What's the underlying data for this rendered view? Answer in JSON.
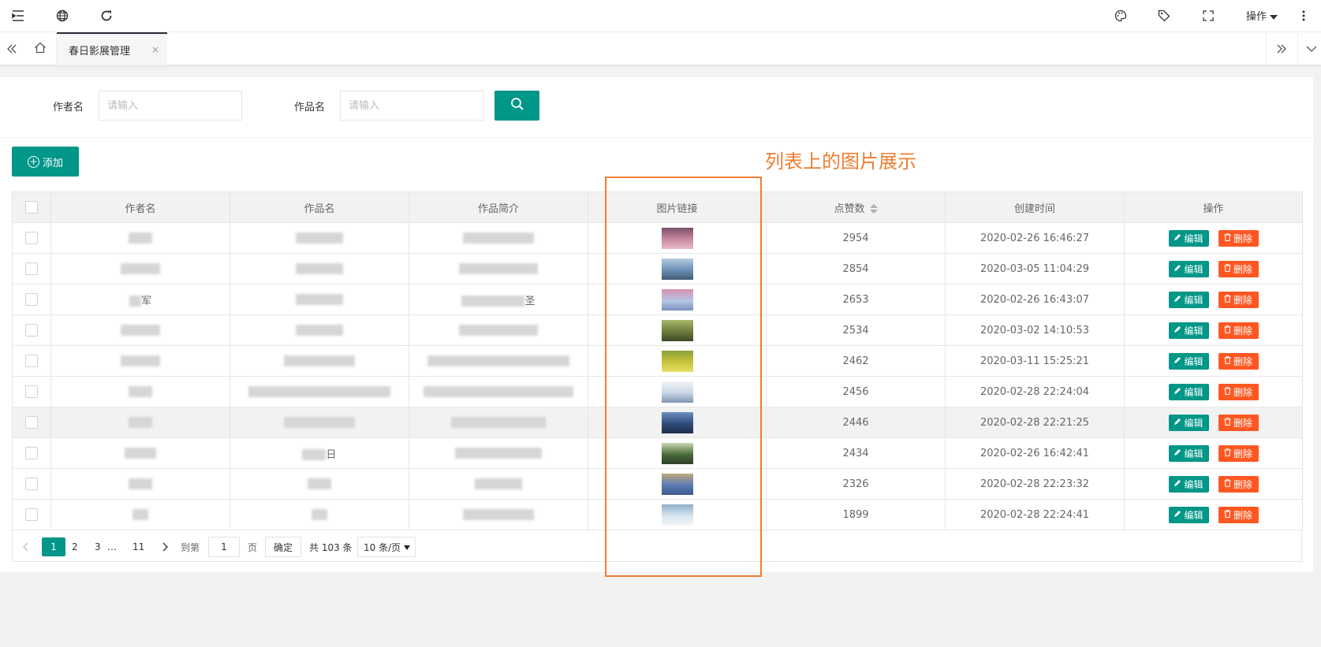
{
  "header": {
    "operations_label": "操作"
  },
  "tabs": {
    "active_label": "春日影展管理",
    "close_glyph": "×"
  },
  "search": {
    "author_label": "作者名",
    "author_placeholder": "请输入",
    "work_label": "作品名",
    "work_placeholder": "请输入"
  },
  "toolbar": {
    "add_label": "添加"
  },
  "annotation": "列表上的图片展示",
  "table": {
    "headers": [
      "作者名",
      "作品名",
      "作品简介",
      "图片链接",
      "点赞数",
      "创建时间",
      "操作"
    ],
    "edit_label": "编辑",
    "delete_label": "删除",
    "rows": [
      {
        "author": "",
        "work": "",
        "intro": "",
        "likes": "2954",
        "created": "2020-02-26 16:46:27"
      },
      {
        "author": "",
        "work": "",
        "intro": "",
        "likes": "2854",
        "created": "2020-03-05 11:04:29"
      },
      {
        "author": "军",
        "work": "",
        "intro": "圣",
        "likes": "2653",
        "created": "2020-02-26 16:43:07"
      },
      {
        "author": "",
        "work": "",
        "intro": "",
        "likes": "2534",
        "created": "2020-03-02 14:10:53"
      },
      {
        "author": "",
        "work": "",
        "intro": "",
        "likes": "2462",
        "created": "2020-03-11 15:25:21"
      },
      {
        "author": "",
        "work": "",
        "intro": "",
        "likes": "2456",
        "created": "2020-02-28 22:24:04"
      },
      {
        "author": "",
        "work": "",
        "intro": "",
        "likes": "2446",
        "created": "2020-02-28 22:21:25"
      },
      {
        "author": "",
        "work": "日",
        "intro": "",
        "likes": "2434",
        "created": "2020-02-26 16:42:41"
      },
      {
        "author": "",
        "work": "",
        "intro": "",
        "likes": "2326",
        "created": "2020-02-28 22:23:32"
      },
      {
        "author": "",
        "work": "",
        "intro": "",
        "likes": "1899",
        "created": "2020-02-28 22:24:41"
      }
    ]
  },
  "pagination": {
    "pages": [
      "1",
      "2",
      "3",
      "…",
      "11"
    ],
    "goto_label": "到第",
    "goto_value": "1",
    "page_unit": "页",
    "confirm_label": "确定",
    "total_label": "共 103 条",
    "page_size_label": "10 条/页"
  }
}
